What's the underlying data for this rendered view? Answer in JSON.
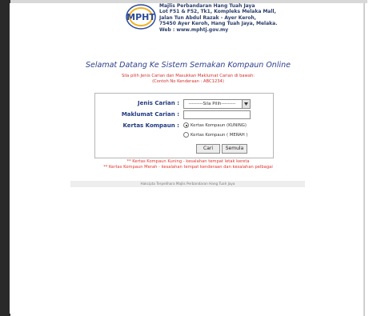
{
  "header": {
    "logo_text": "MPHT",
    "org_lines": [
      "Majlis Perbandaran Hang Tuah Jaya",
      "Lot F51 & F52, Tk1, Kompleks Melaka Mall,",
      "Jalan Tun Abdul Razak - Ayer Keroh,",
      "75450 Ayer Keroh, Hang Tuah Jaya, Melaka.",
      "Web : www.mphtj.gov.my"
    ]
  },
  "welcome": "Selamat Datang Ke Sistem Semakan Kompaun Online",
  "instructions": [
    "Sila pilih Jenis Carian dan Masukkan Maklumat Carian di bawah:",
    "(Contoh No Kenderaan : ABC1234)"
  ],
  "form": {
    "jenis_label": "Jenis Carian :",
    "jenis_selected": "---------Sila Pilih---------",
    "maklumat_label": "Maklumat Carian :",
    "maklumat_value": "",
    "kertas_label": "Kertas Kompaun :",
    "radio_kuning": "Kertas Kompaun (KUNING)",
    "radio_merah": "Kertas Kompaun ( MERAH )",
    "radio_selected": "kuning",
    "cari_label": "Cari",
    "semula_label": "Semula"
  },
  "notes": [
    "** Kertas Kompaun Kuning - kesalahan tempat letak kereta",
    "** Kertas Kompaun Merah - kesalahan tempat kenderaan dan kesalahan pelbagai"
  ],
  "footer": "Hakcipta Terpelihara Majlis Perbandaran Hang Tuah Jaya",
  "colors": {
    "label_blue": "#213a80",
    "welcome_blue": "#2d3f8f",
    "note_red": "#e0332c"
  }
}
